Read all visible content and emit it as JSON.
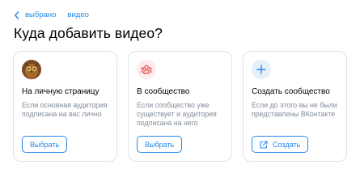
{
  "breadcrumb": {
    "back_icon": "chevron-left-icon",
    "items": [
      "выбрано",
      "видео"
    ]
  },
  "title": "Куда добавить видео?",
  "cards": [
    {
      "icon": "user-avatar",
      "title": "На личную страницу",
      "description": "Если основная аудитория подписана на вас лично",
      "button": "Выбрать"
    },
    {
      "icon": "users-icon",
      "title": "В сообщество",
      "description": "Если сообщество уже существует и аудитория подписана на него",
      "button": "Выбрать"
    },
    {
      "icon": "plus-icon",
      "title": "Создать сообщество",
      "description": "Если до этого вы не были представлены ВКонтакте",
      "button_icon": "external-link-icon",
      "button": "Создать"
    }
  ],
  "colors": {
    "accent": "#2688eb",
    "secondary_text": "#818c99",
    "border": "#dce1e6",
    "community_icon": "#e64646",
    "community_bg": "#fdeceb",
    "create_bg": "#e6f0fb"
  }
}
